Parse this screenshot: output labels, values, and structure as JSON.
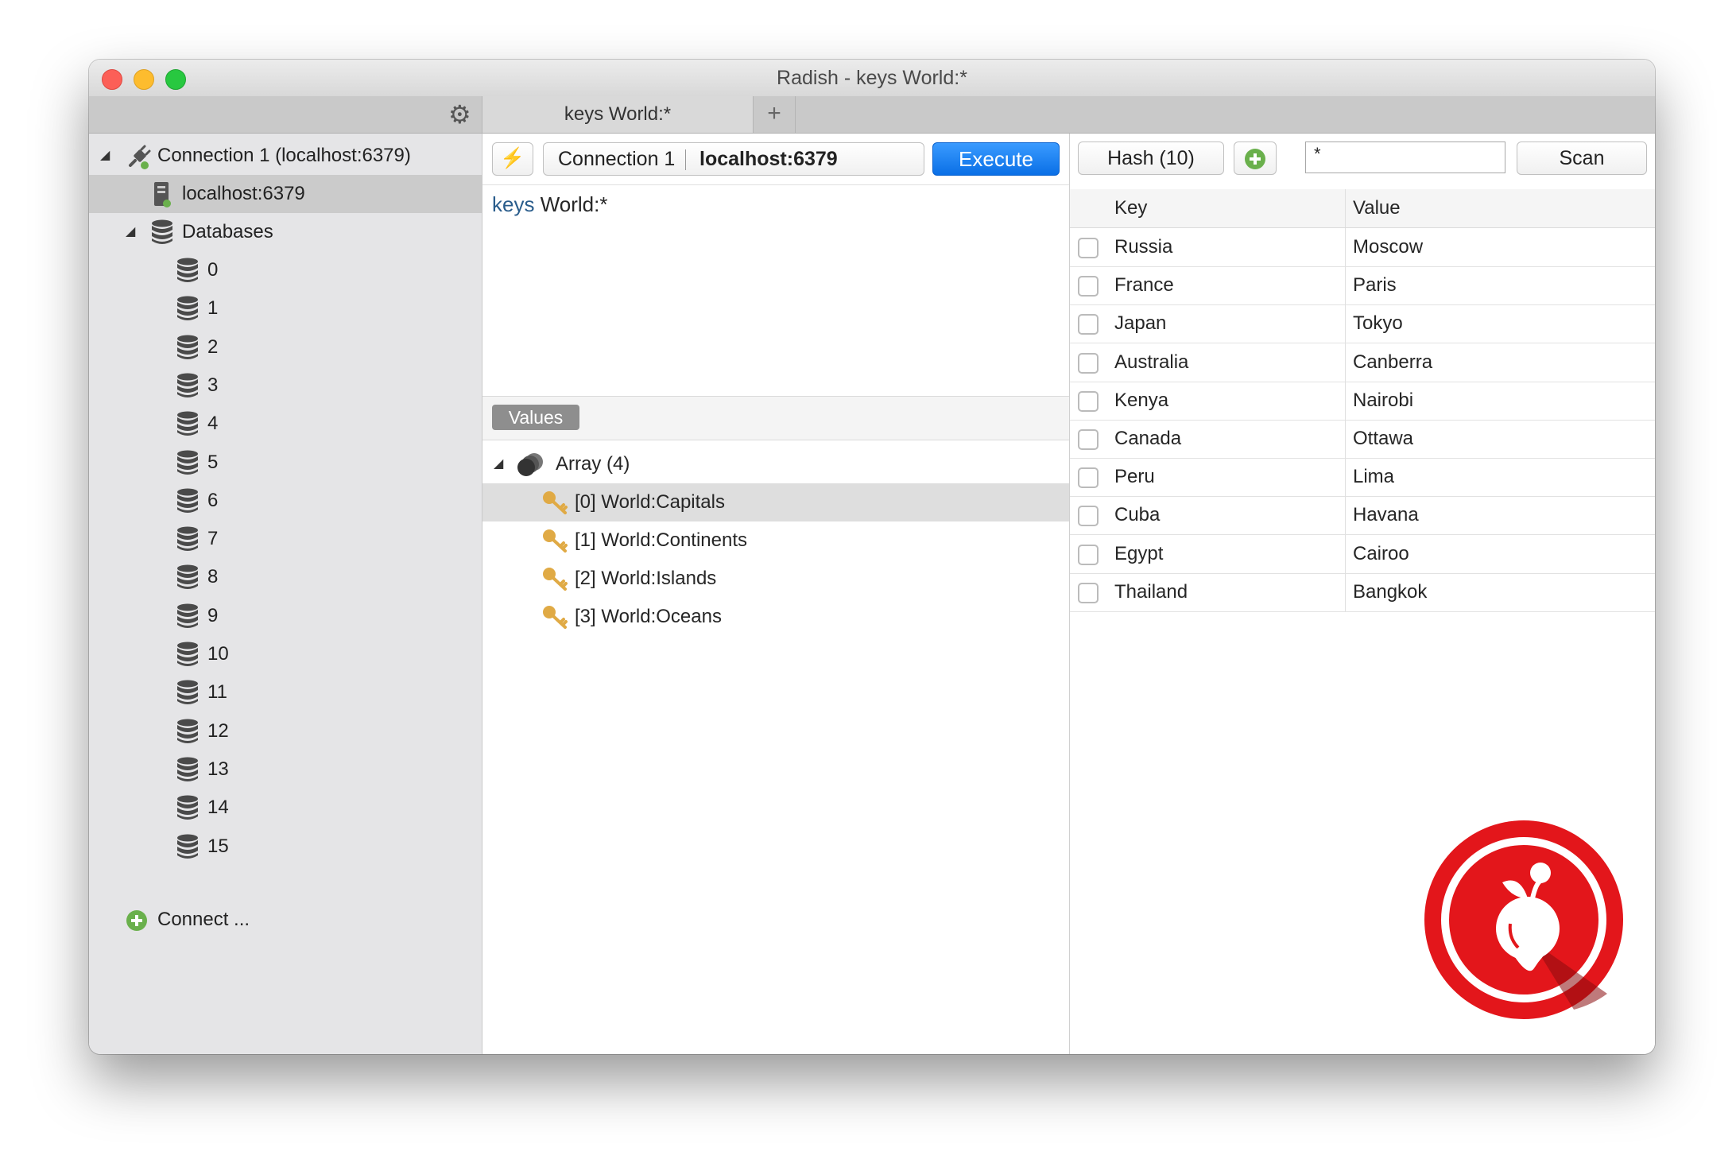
{
  "window": {
    "title": "Radish - keys World:*"
  },
  "tabs": {
    "active_label": "keys World:*",
    "add_label": "+"
  },
  "sidebar": {
    "connection_label": "Connection 1 (localhost:6379)",
    "host_label": "localhost:6379",
    "databases_label": "Databases",
    "databases": [
      "0",
      "1",
      "2",
      "3",
      "4",
      "5",
      "6",
      "7",
      "8",
      "9",
      "10",
      "11",
      "12",
      "13",
      "14",
      "15"
    ],
    "connect_label": "Connect ..."
  },
  "query": {
    "connection_name": "Connection 1",
    "host": "localhost:6379",
    "execute_label": "Execute",
    "command_keyword": "keys",
    "command_arg": "World:*"
  },
  "values": {
    "tab_label": "Values",
    "root_label": "Array",
    "root_count": "(4)",
    "items": [
      "[0] World:Capitals",
      "[1] World:Continents",
      "[2] World:Islands",
      "[3] World:Oceans"
    ]
  },
  "hash": {
    "type_label": "Hash (10)",
    "filter_value": "*",
    "scan_label": "Scan",
    "headers": {
      "key": "Key",
      "value": "Value"
    },
    "rows": [
      {
        "key": "Russia",
        "value": "Moscow"
      },
      {
        "key": "France",
        "value": "Paris"
      },
      {
        "key": "Japan",
        "value": "Tokyo"
      },
      {
        "key": "Australia",
        "value": "Canberra"
      },
      {
        "key": "Kenya",
        "value": "Nairobi"
      },
      {
        "key": "Canada",
        "value": "Ottawa"
      },
      {
        "key": "Peru",
        "value": "Lima"
      },
      {
        "key": "Cuba",
        "value": "Havana"
      },
      {
        "key": "Egypt",
        "value": "Cairoo"
      },
      {
        "key": "Thailand",
        "value": "Bangkok"
      }
    ]
  },
  "colors": {
    "accent": "#0a6fe6",
    "logo_red": "#e3161b",
    "key_gold": "#e0aa45"
  }
}
